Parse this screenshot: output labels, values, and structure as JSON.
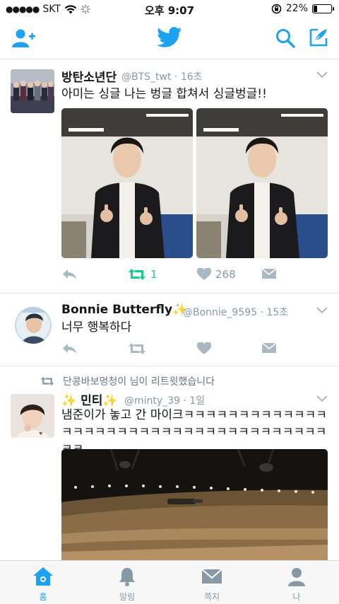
{
  "status_bar": {
    "carrier": "SKT",
    "time": "오후 9:07",
    "battery": "22%",
    "battery_level": 0.22
  },
  "nav": {
    "add_user_icon": "add-user-icon",
    "logo_icon": "twitter-bird-icon",
    "search_icon": "search-icon",
    "compose_icon": "compose-icon"
  },
  "tweets": [
    {
      "name": "방탄소년단",
      "handle": "@BTS_twt · 16초",
      "text": "아미는 싱글 나는 벙글 합쳐서 싱글벙글!!",
      "retweets": "1",
      "likes": "268"
    },
    {
      "name": "Bonnie Butterfly✨",
      "handle": "@Bonnie_9595 · 15초",
      "text": "너무 행복하다"
    },
    {
      "retweet_context": "단콩바보멍청이 님이 리트윗했습니다",
      "name": "✨ 민티✨",
      "handle": "@minty_39 · 1일",
      "text": "냄준이가 놓고 간 마이크ㅋㅋㅋㅋㅋㅋㅋㅋㅋㅋㅋㅋㅋㅋㅋㅋㅋㅋㅋㅋㅋㅋㅋㅋㅋㅋㅋㅋㅋㅋㅋㅋㅋㅋㅋㅋㅋㅋㅋ"
    }
  ],
  "tabs": [
    {
      "label": "홈",
      "icon": "home-icon",
      "active": true
    },
    {
      "label": "알림",
      "icon": "bell-icon",
      "active": false
    },
    {
      "label": "쪽지",
      "icon": "envelope-icon",
      "active": false
    },
    {
      "label": "나",
      "icon": "person-icon",
      "active": false
    }
  ],
  "colors": {
    "brand_blue": "#1da1f2",
    "retweet_green": "#19cf86",
    "muted_gray": "#8899a6"
  }
}
